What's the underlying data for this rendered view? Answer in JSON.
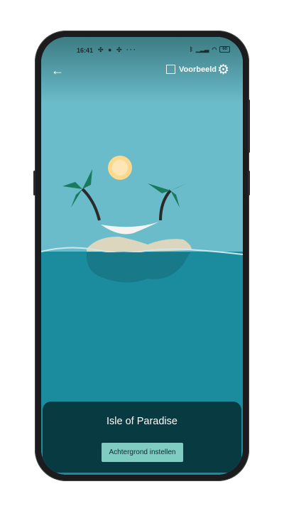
{
  "status_bar": {
    "time": "16:41",
    "notification_icons": [
      "slack-icon",
      "messenger-icon",
      "slack-icon",
      "more-icon"
    ],
    "more": "···",
    "battery": "60"
  },
  "toolbar": {
    "back_icon": "arrow-left-icon",
    "back": "←",
    "preview_label": "Voorbeeld",
    "preview_checked": false,
    "settings_icon": "gear-icon",
    "settings": "⚙"
  },
  "wallpaper": {
    "title": "Isle of Paradise",
    "set_button": "Achtergrond instellen"
  },
  "colors": {
    "sky": "#6bbccb",
    "sea": "#1a8c9e",
    "panel": "#083a42",
    "button": "#7fccc3",
    "sun": "#fcd98f"
  }
}
